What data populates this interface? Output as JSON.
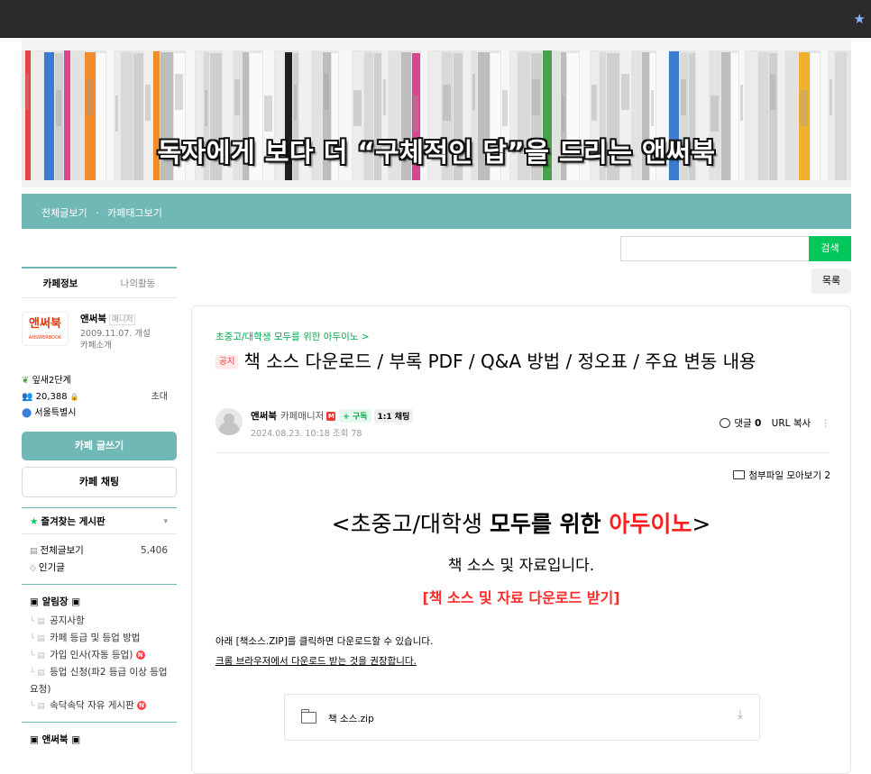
{
  "banner": {
    "title": "독자에게 보다 더 “구체적인 답”을 드리는 앤써북"
  },
  "nav": {
    "all_posts": "전체글보기",
    "separator": "·",
    "tags": "카페태그보기"
  },
  "search": {
    "placeholder": "",
    "button_label": "검색"
  },
  "list_button": "목록",
  "sidebar": {
    "tabs": [
      "카페정보",
      "나의활동"
    ],
    "cafe_logo_text": "앤써북",
    "cafe_logo_sub": "ANSWERBOOK",
    "manager_name": "앤써북",
    "manager_badge": "매니저",
    "opened": "2009.11.07. 개설",
    "intro_link": "카페소개",
    "level": "잎새2단계",
    "members": "20,388",
    "invite": "초대",
    "region": "서울특별시",
    "write_button": "카페 글쓰기",
    "chat_button": "카페 채팅",
    "favorites": "즐겨찾는 게시판",
    "menu": {
      "all_posts": "전체글보기",
      "all_posts_count": "5,406",
      "popular": "인기글",
      "group1": "▣ 알림장 ▣",
      "sub": [
        "공지사항",
        "카페 등급 및 등업 방법",
        "가입 인사(자동 등업)",
        "등업 신청(파2 등급 이상 등업 요청)",
        "속닥속닥 자유 게시판"
      ],
      "group2": "▣ 앤써북 ▣"
    }
  },
  "article": {
    "breadcrumb": "초중고/대학생 모두를 위한 아두이노 >",
    "notice_tag": "공지",
    "title": "책 소스 다운로드 / 부록 PDF / Q&A 방법 / 정오표 / 주요 변동 내용",
    "author": "앤써북",
    "author_grade": "카페매니저",
    "subscribe": "+ 구독",
    "chat_tag": "1:1 채팅",
    "date": "2024.08.23. 10:18",
    "views": "조회 78",
    "comments_label": "댓글",
    "comments_count": "0",
    "url_copy": "URL 복사",
    "attachments": "첨부파일 모아보기 2",
    "content": {
      "heading_pre": "<초중고/대학생 ",
      "heading_bold": "모두를 위한 ",
      "heading_red": "아두이노",
      "heading_post": ">",
      "subtitle": "책 소스 및 자료입니다.",
      "link": "[책 소스 및 자료 다운로드 받기]",
      "p1": "아래 [책소스.ZIP]를 클릭하면 다운로드할 수 있습니다.",
      "p2": "크롬 브라우저에서 다운로드 받는 것을 권장합니다.",
      "file_name": "책 소스.zip"
    }
  },
  "colors": {
    "accent": "#70b8b6",
    "green": "#03c75a",
    "red": "#ff1e1e"
  }
}
